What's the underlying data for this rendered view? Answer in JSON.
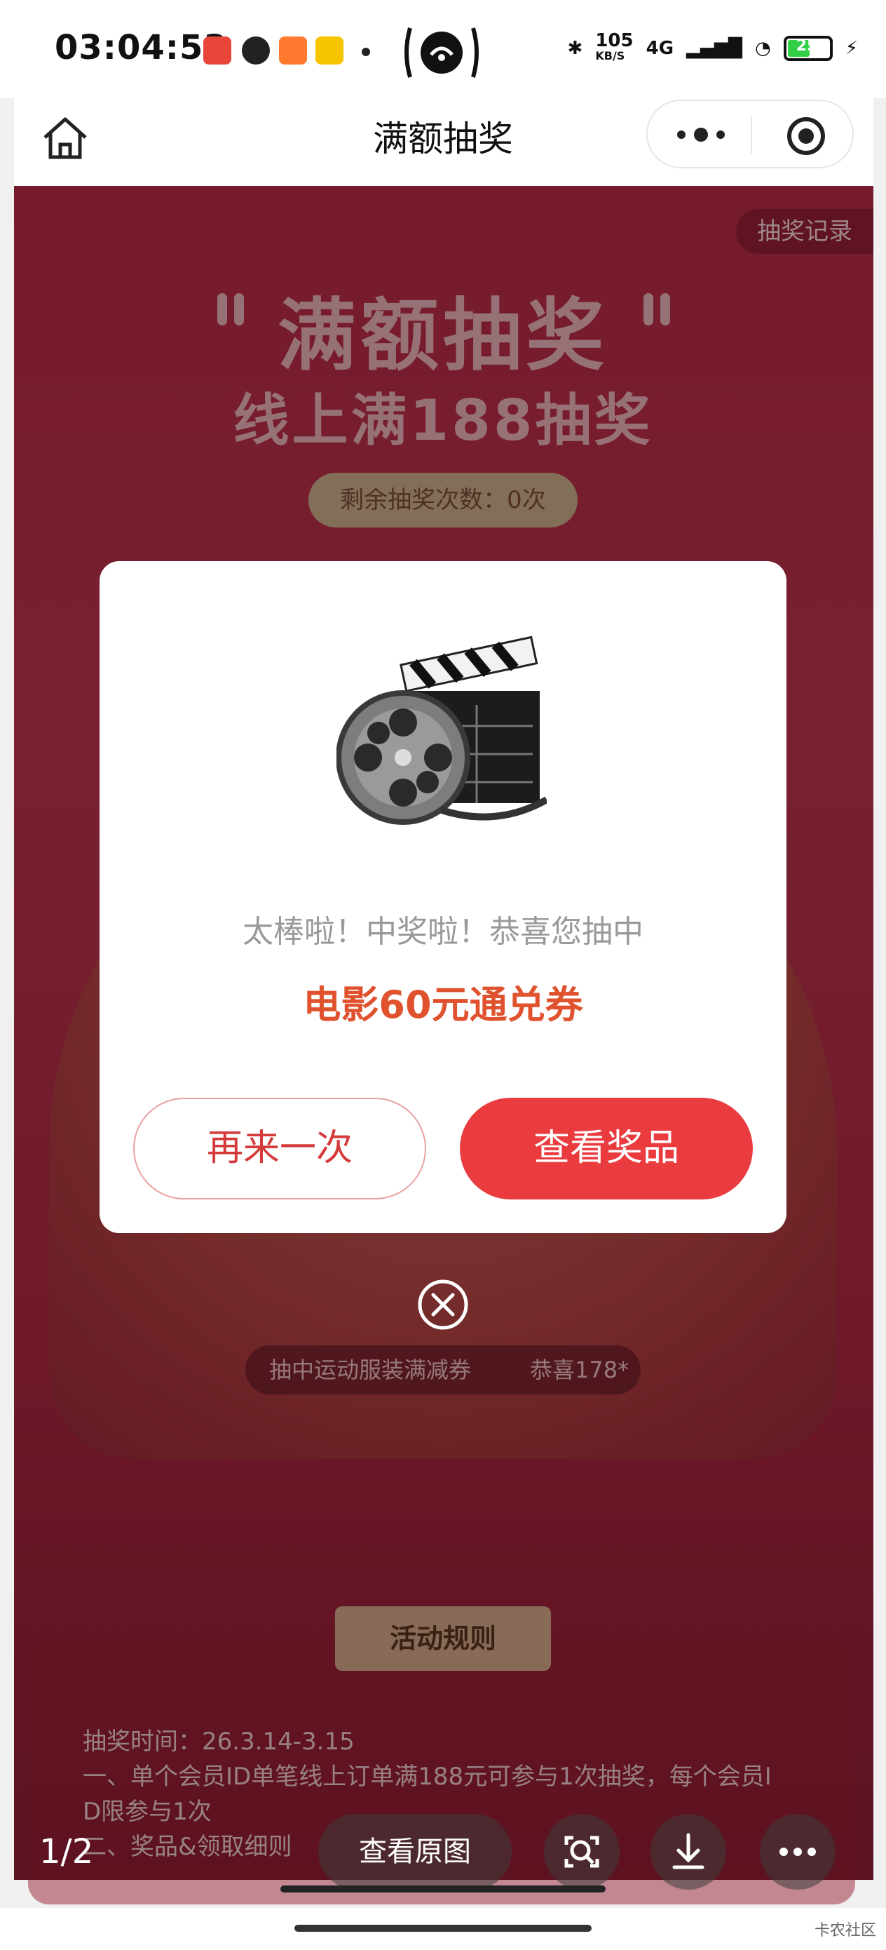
{
  "status_bar": {
    "time": "03:04:53",
    "net_speed": "105",
    "net_unit": "KB/S",
    "signal": "4G",
    "battery": "25"
  },
  "nav": {
    "title": "满额抽奖"
  },
  "page": {
    "record_button": "抽奖记录",
    "headline": "满额抽奖",
    "subheadline": "线上满188抽奖",
    "remaining_draws": "剩余抽奖次数：0次",
    "winning_ticker": {
      "left": "抽中运动服装满减券",
      "right": "恭喜178*"
    },
    "rules_tab": "活动规则",
    "rules": [
      "抽奖时间：26.3.14-3.15",
      "一、单个会员ID单笔线上订单满188元可参与1次抽奖，每个会员I",
      "D限参与1次",
      "二、奖品&领取细则"
    ]
  },
  "dialog": {
    "image_icon": "film-clapperboard-reel-icon",
    "message": "太棒啦！中奖啦！恭喜您抽中",
    "prize": "电影60元通兑券",
    "again_button": "再来一次",
    "view_button": "查看奖品",
    "close_icon": "close-circle-icon"
  },
  "viewer": {
    "pager": "1/2",
    "view_original": "查看原图",
    "icons": [
      "scan-search-icon",
      "download-icon",
      "more-icon"
    ]
  },
  "watermark": "卡农社区",
  "colors": {
    "primary_red": "#ea3b3f",
    "prize_orange": "#e0522e",
    "page_bg": "#b62a44"
  }
}
